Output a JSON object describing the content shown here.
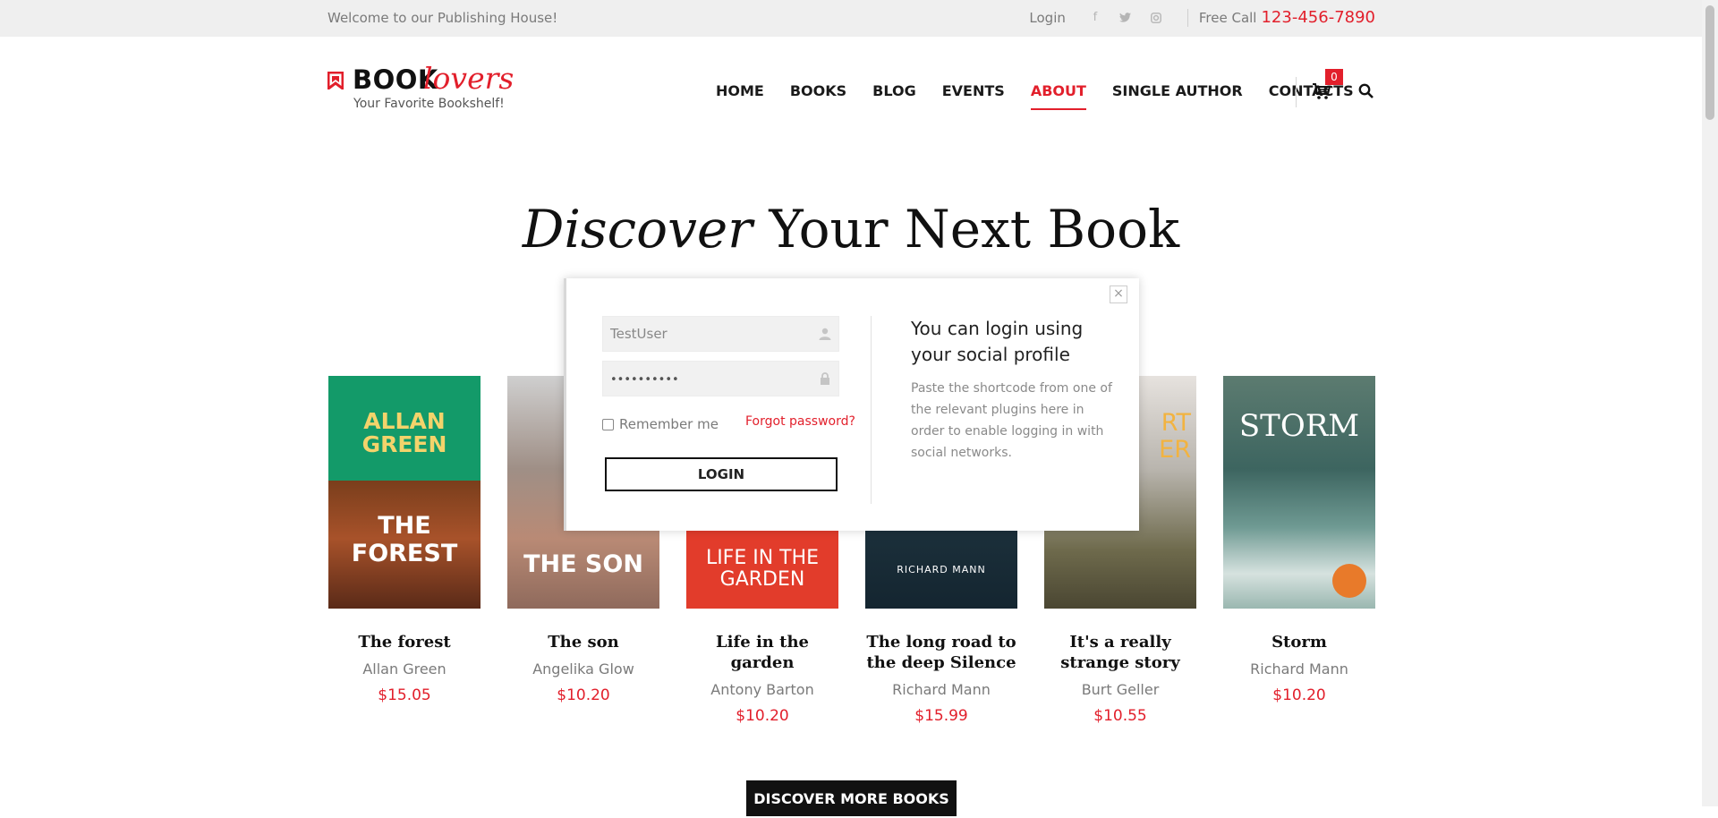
{
  "topbar": {
    "welcome": "Welcome to our Publishing House!",
    "login": "Login",
    "social_icons": [
      "facebook-icon",
      "twitter-icon",
      "instagram-icon"
    ],
    "free_call_label": "Free Call",
    "phone": "123-456-7890"
  },
  "header": {
    "logo_book": "BOOK",
    "logo_lovers": "lovers",
    "tagline": "Your Favorite Bookshelf!",
    "nav": [
      {
        "label": "HOME"
      },
      {
        "label": "BOOKS"
      },
      {
        "label": "BLOG"
      },
      {
        "label": "EVENTS"
      },
      {
        "label": "ABOUT",
        "active": true
      },
      {
        "label": "SINGLE AUTHOR"
      },
      {
        "label": "CONTACTS"
      }
    ],
    "cart_count": "0"
  },
  "hero": {
    "title_italic": "Discover",
    "title_rest": " Your Next Book"
  },
  "books": [
    {
      "title": "The forest",
      "author": "Allan Green",
      "price": "$15.05",
      "cover_text": "ALLAN GREEN / THE FOREST"
    },
    {
      "title": "The son",
      "author": "Angelika Glow",
      "price": "$10.20",
      "cover_text": "THE SON"
    },
    {
      "title": "Life in the garden",
      "author": "Antony Barton",
      "price": "$10.20",
      "cover_text": "LIFE IN THE GARDEN"
    },
    {
      "title": "The long road to the deep Silence",
      "author": "Richard Mann",
      "price": "$15.99",
      "cover_text": "RICHARD MANN"
    },
    {
      "title": "It's a really strange story",
      "author": "Burt Geller",
      "price": "$10.55",
      "cover_text": "RT ER"
    },
    {
      "title": "Storm",
      "author": "Richard Mann",
      "price": "$10.20",
      "cover_text": "STORM"
    }
  ],
  "discover_button": "DISCOVER MORE BOOKS",
  "modal": {
    "username_value": "TestUser",
    "password_value": "••••••••••",
    "remember_label": "Remember me",
    "forgot_label": "Forgot password?",
    "login_button": "LOGIN",
    "social_title": "You can login using your social profile",
    "social_text": "Paste the shortcode from one of the relevant plugins here in order to enable logging in with social networks.",
    "close_label": "×"
  },
  "colors": {
    "accent": "#e21f2b",
    "topbar_bg": "#efefef",
    "text_dark": "#111111",
    "text_muted": "#7a7a7a"
  }
}
